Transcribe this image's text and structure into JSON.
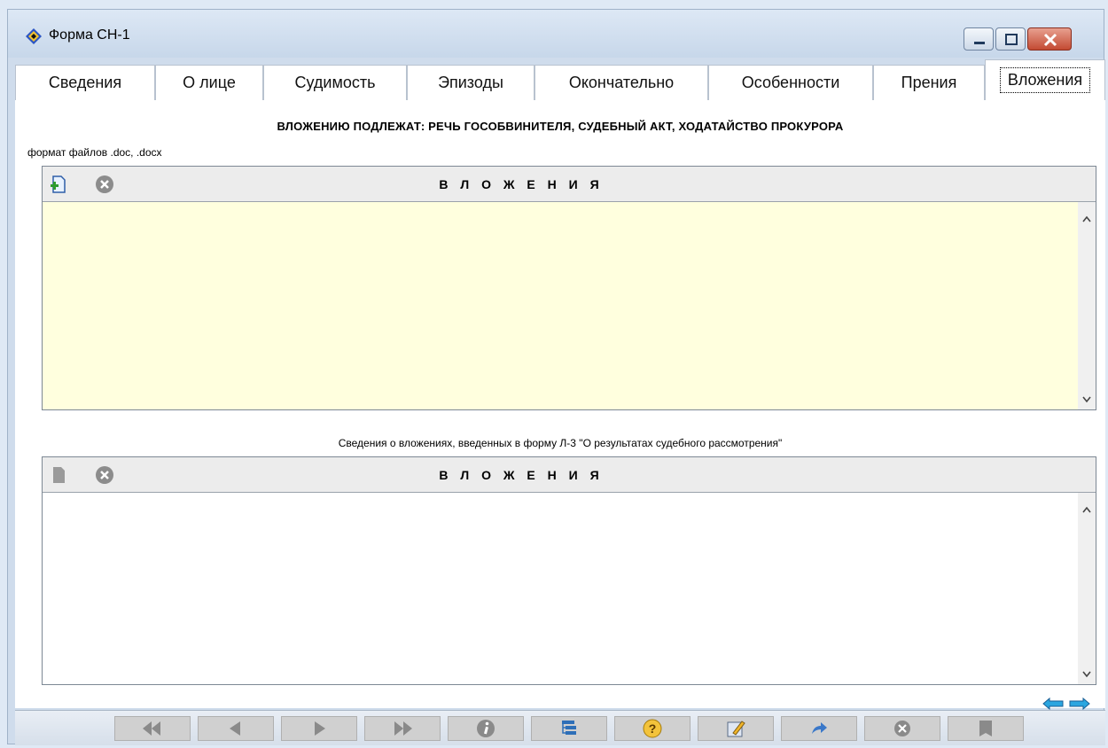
{
  "window": {
    "title": "Форма СН-1"
  },
  "tabs": [
    {
      "label": "Сведения"
    },
    {
      "label": "О лице"
    },
    {
      "label": "Судимость"
    },
    {
      "label": "Эпизоды"
    },
    {
      "label": "Окончательно"
    },
    {
      "label": "Особенности"
    },
    {
      "label": "Прения"
    },
    {
      "label": "Вложения",
      "active": true
    }
  ],
  "content": {
    "notice": "ВЛОЖЕНИЮ ПОДЛЕЖАТ: РЕЧЬ ГОСОБВИНИТЕЛЯ, СУДЕБНЫЙ АКТ, ХОДАТАЙСТВО ПРОКУРОРА",
    "file_format": "формат файлов .doc, .docx",
    "panel1": {
      "title": "В Л О Ж Е Н И Я",
      "add_icon": "add-file-icon",
      "delete_icon": "delete-icon"
    },
    "caption": "Сведения о вложениях, введенных в форму Л-3 \"О результатах судебного рассмотрения\"",
    "panel2": {
      "title": "В Л О Ж Е Н И Я",
      "add_icon": "add-file-disabled-icon",
      "delete_icon": "delete-icon"
    }
  },
  "toolbar": {
    "buttons": [
      "first-icon",
      "prev-icon",
      "next-icon",
      "last-icon",
      "info-icon",
      "tree-icon",
      "help-icon",
      "edit-icon",
      "forward-icon",
      "cancel-icon",
      "save-icon"
    ]
  },
  "colors": {
    "panel1_bg": "#ffffde",
    "panel2_bg": "#ffffff"
  }
}
